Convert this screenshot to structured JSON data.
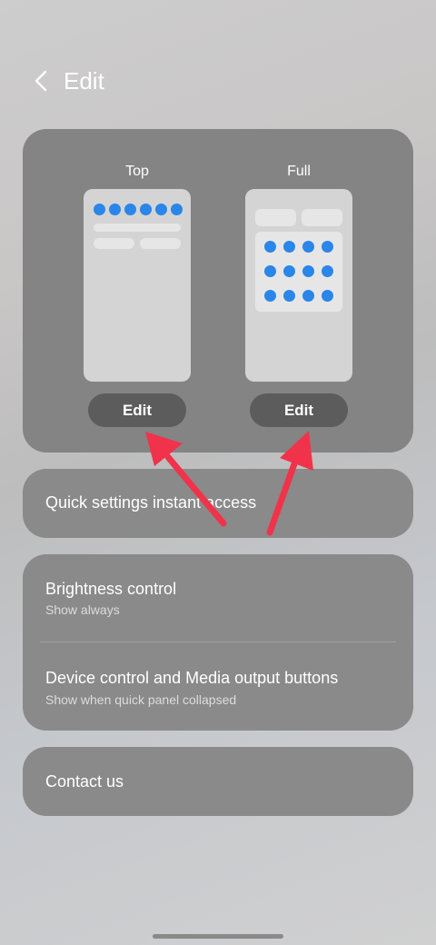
{
  "header": {
    "back_icon": "chevron-left-icon",
    "title": "Edit"
  },
  "preview": {
    "top": {
      "label": "Top",
      "edit_label": "Edit"
    },
    "full": {
      "label": "Full",
      "edit_label": "Edit"
    },
    "dot_color": "#2a86e8"
  },
  "items": {
    "quick_settings": {
      "title": "Quick settings instant access"
    },
    "brightness": {
      "title": "Brightness control",
      "subtitle": "Show always"
    },
    "device_control": {
      "title": "Device control and Media output buttons",
      "subtitle": "Show when quick panel collapsed"
    },
    "contact": {
      "title": "Contact us"
    }
  },
  "annotation_color": "#f0334a"
}
